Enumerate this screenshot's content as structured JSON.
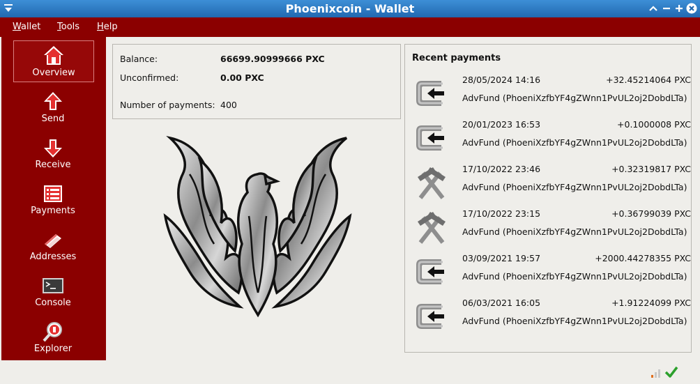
{
  "window": {
    "title": "Phoenixcoin - Wallet"
  },
  "menubar": {
    "items": [
      "Wallet",
      "Tools",
      "Help"
    ]
  },
  "sidebar": {
    "items": [
      {
        "label": "Overview",
        "icon": "home-icon",
        "active": true
      },
      {
        "label": "Send",
        "icon": "send-arrow-icon"
      },
      {
        "label": "Receive",
        "icon": "receive-arrow-icon"
      },
      {
        "label": "Payments",
        "icon": "payments-list-icon"
      },
      {
        "label": "Addresses",
        "icon": "address-book-icon"
      },
      {
        "label": "Console",
        "icon": "console-icon"
      },
      {
        "label": "Explorer",
        "icon": "explorer-magnifier-icon"
      }
    ]
  },
  "overview": {
    "balance_label": "Balance:",
    "balance_value": "66699.90999666 PXC",
    "unconfirmed_label": "Unconfirmed:",
    "unconfirmed_value": "0.00 PXC",
    "num_payments_label": "Number of payments:",
    "num_payments_value": "400"
  },
  "recent": {
    "title": "Recent payments",
    "items": [
      {
        "type": "received",
        "icon": "receive-payment-icon",
        "date": "28/05/2024 14:16",
        "amount": "+32.45214064 PXC",
        "address": "AdvFund (PhoeniXzfbYF4gZWnn1PvUL2oj2DobdLTa)"
      },
      {
        "type": "received",
        "icon": "receive-payment-icon",
        "date": "20/01/2023 16:53",
        "amount": "+0.1000008 PXC",
        "address": "AdvFund (PhoeniXzfbYF4gZWnn1PvUL2oj2DobdLTa)"
      },
      {
        "type": "mined",
        "icon": "mining-hammers-icon",
        "date": "17/10/2022 23:46",
        "amount": "+0.32319817 PXC",
        "address": "AdvFund (PhoeniXzfbYF4gZWnn1PvUL2oj2DobdLTa)"
      },
      {
        "type": "mined",
        "icon": "mining-hammers-icon",
        "date": "17/10/2022 23:15",
        "amount": "+0.36799039 PXC",
        "address": "AdvFund (PhoeniXzfbYF4gZWnn1PvUL2oj2DobdLTa)"
      },
      {
        "type": "received",
        "icon": "receive-payment-icon",
        "date": "03/09/2021 19:57",
        "amount": "+2000.44278355 PXC",
        "address": "AdvFund (PhoeniXzfbYF4gZWnn1PvUL2oj2DobdLTa)"
      },
      {
        "type": "received",
        "icon": "receive-payment-icon",
        "date": "06/03/2021 16:05",
        "amount": "+1.91224099 PXC",
        "address": "AdvFund (PhoeniXzfbYF4gZWnn1PvUL2oj2DobdLTa)"
      }
    ]
  },
  "status": {
    "connections_icon": "signal-bars-icon",
    "sync_icon": "synced-checkmark-icon"
  },
  "colors": {
    "sidebar": "#8b0000",
    "titlebar": "#2a74bd",
    "background": "#efeeea",
    "sync_ok": "#2ca02c"
  }
}
